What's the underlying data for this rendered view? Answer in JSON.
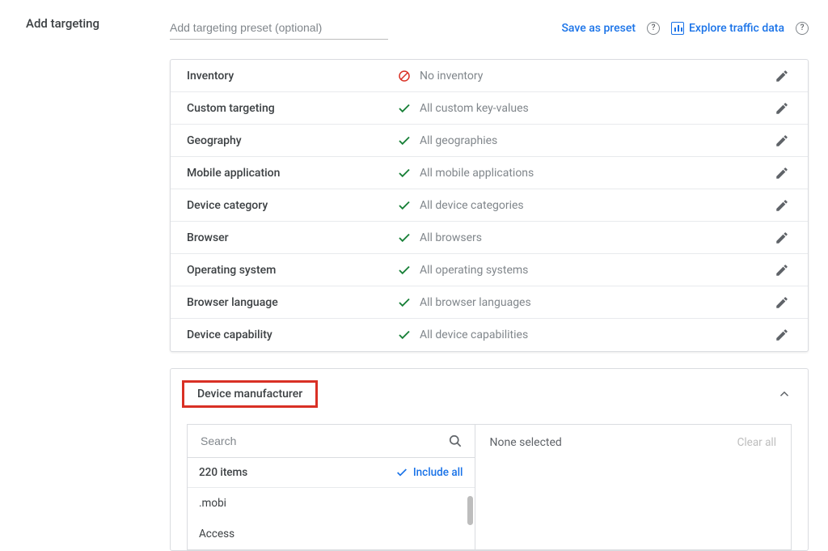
{
  "page_title": "Add targeting",
  "preset_placeholder": "Add targeting preset (optional)",
  "save_preset": "Save as preset",
  "explore_link": "Explore traffic data",
  "targeting_rows": [
    {
      "label": "Inventory",
      "status_text": "No inventory",
      "status_kind": "no"
    },
    {
      "label": "Custom targeting",
      "status_text": "All custom key-values",
      "status_kind": "ok"
    },
    {
      "label": "Geography",
      "status_text": "All geographies",
      "status_kind": "ok"
    },
    {
      "label": "Mobile application",
      "status_text": "All mobile applications",
      "status_kind": "ok"
    },
    {
      "label": "Device category",
      "status_text": "All device categories",
      "status_kind": "ok"
    },
    {
      "label": "Browser",
      "status_text": "All browsers",
      "status_kind": "ok"
    },
    {
      "label": "Operating system",
      "status_text": "All operating systems",
      "status_kind": "ok"
    },
    {
      "label": "Browser language",
      "status_text": "All browser languages",
      "status_kind": "ok"
    },
    {
      "label": "Device capability",
      "status_text": "All device capabilities",
      "status_kind": "ok"
    }
  ],
  "expanded": {
    "title": "Device manufacturer",
    "search_placeholder": "Search",
    "count_text": "220 items",
    "include_all": "Include all",
    "items": [
      ".mobi",
      "Access"
    ],
    "none_selected": "None selected",
    "clear_all": "Clear all"
  }
}
